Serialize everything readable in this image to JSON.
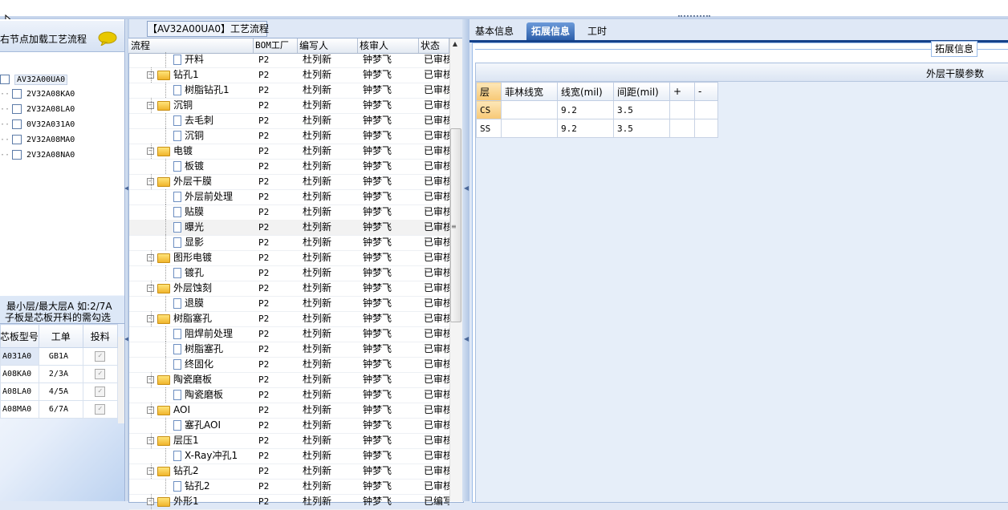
{
  "left": {
    "header": "右节点加载工艺流程",
    "root": "AV32A00UA0",
    "items": [
      "2V32A08KA0",
      "2V32A08LA0",
      "0V32A031A0",
      "2V32A08MA0",
      "2V32A08NA0"
    ],
    "hint_line1": "最小层/最大层A 如:2/7A",
    "hint_line2": "子板是芯板开料的需勾选",
    "table": {
      "headers": [
        "芯板型号",
        "工单",
        "投料"
      ],
      "rows": [
        {
          "model": "A031A0",
          "order": "GB1A"
        },
        {
          "model": "A08KA0",
          "order": "2/3A"
        },
        {
          "model": "A08LA0",
          "order": "4/5A"
        },
        {
          "model": "A08MA0",
          "order": "6/7A"
        }
      ]
    }
  },
  "middle": {
    "title": "【AV32A00UA0】工艺流程",
    "columns": [
      "流程",
      "BOM工厂",
      "编写人",
      "核审人",
      "状态"
    ],
    "rows": [
      {
        "name": "开料",
        "level": 1,
        "type": "doc",
        "bom": "P2",
        "writer": "杜列新",
        "reviewer": "钟梦飞",
        "status": "已审核"
      },
      {
        "name": "钻孔1",
        "level": 0,
        "type": "folder",
        "bom": "P2",
        "writer": "杜列新",
        "reviewer": "钟梦飞",
        "status": "已审核"
      },
      {
        "name": "树脂钻孔1",
        "level": 1,
        "type": "doc",
        "bom": "P2",
        "writer": "杜列新",
        "reviewer": "钟梦飞",
        "status": "已审核"
      },
      {
        "name": "沉铜",
        "level": 0,
        "type": "folder",
        "bom": "P2",
        "writer": "杜列新",
        "reviewer": "钟梦飞",
        "status": "已审核"
      },
      {
        "name": "去毛刺",
        "level": 1,
        "type": "doc",
        "bom": "P2",
        "writer": "杜列新",
        "reviewer": "钟梦飞",
        "status": "已审核"
      },
      {
        "name": "沉铜",
        "level": 1,
        "type": "doc",
        "bom": "P2",
        "writer": "杜列新",
        "reviewer": "钟梦飞",
        "status": "已审核"
      },
      {
        "name": "电镀",
        "level": 0,
        "type": "folder",
        "bom": "P2",
        "writer": "杜列新",
        "reviewer": "钟梦飞",
        "status": "已审核"
      },
      {
        "name": "板镀",
        "level": 1,
        "type": "doc",
        "bom": "P2",
        "writer": "杜列新",
        "reviewer": "钟梦飞",
        "status": "已审核"
      },
      {
        "name": "外层干膜",
        "level": 0,
        "type": "folder",
        "bom": "P2",
        "writer": "杜列新",
        "reviewer": "钟梦飞",
        "status": "已审核"
      },
      {
        "name": "外层前处理",
        "level": 1,
        "type": "doc",
        "bom": "P2",
        "writer": "杜列新",
        "reviewer": "钟梦飞",
        "status": "已审核"
      },
      {
        "name": "贴膜",
        "level": 1,
        "type": "doc",
        "bom": "P2",
        "writer": "杜列新",
        "reviewer": "钟梦飞",
        "status": "已审核"
      },
      {
        "name": "曝光",
        "level": 1,
        "type": "doc",
        "bom": "P2",
        "writer": "杜列新",
        "reviewer": "钟梦飞",
        "status": "已审核",
        "highlight": true
      },
      {
        "name": "显影",
        "level": 1,
        "type": "doc",
        "bom": "P2",
        "writer": "杜列新",
        "reviewer": "钟梦飞",
        "status": "已审核"
      },
      {
        "name": "图形电镀",
        "level": 0,
        "type": "folder",
        "bom": "P2",
        "writer": "杜列新",
        "reviewer": "钟梦飞",
        "status": "已审核"
      },
      {
        "name": "镀孔",
        "level": 1,
        "type": "doc",
        "bom": "P2",
        "writer": "杜列新",
        "reviewer": "钟梦飞",
        "status": "已审核"
      },
      {
        "name": "外层蚀刻",
        "level": 0,
        "type": "folder",
        "bom": "P2",
        "writer": "杜列新",
        "reviewer": "钟梦飞",
        "status": "已审核"
      },
      {
        "name": "退膜",
        "level": 1,
        "type": "doc",
        "bom": "P2",
        "writer": "杜列新",
        "reviewer": "钟梦飞",
        "status": "已审核"
      },
      {
        "name": "树脂塞孔",
        "level": 0,
        "type": "folder",
        "bom": "P2",
        "writer": "杜列新",
        "reviewer": "钟梦飞",
        "status": "已审核"
      },
      {
        "name": "阻焊前处理",
        "level": 1,
        "type": "doc",
        "bom": "P2",
        "writer": "杜列新",
        "reviewer": "钟梦飞",
        "status": "已审核"
      },
      {
        "name": "树脂塞孔",
        "level": 1,
        "type": "doc",
        "bom": "P2",
        "writer": "杜列新",
        "reviewer": "钟梦飞",
        "status": "已审核"
      },
      {
        "name": "终固化",
        "level": 1,
        "type": "doc",
        "bom": "P2",
        "writer": "杜列新",
        "reviewer": "钟梦飞",
        "status": "已审核"
      },
      {
        "name": "陶瓷磨板",
        "level": 0,
        "type": "folder",
        "bom": "P2",
        "writer": "杜列新",
        "reviewer": "钟梦飞",
        "status": "已审核"
      },
      {
        "name": "陶瓷磨板",
        "level": 1,
        "type": "doc",
        "bom": "P2",
        "writer": "杜列新",
        "reviewer": "钟梦飞",
        "status": "已审核"
      },
      {
        "name": "AOI",
        "level": 0,
        "type": "folder",
        "bom": "P2",
        "writer": "杜列新",
        "reviewer": "钟梦飞",
        "status": "已审核"
      },
      {
        "name": "塞孔AOI",
        "level": 1,
        "type": "doc",
        "bom": "P2",
        "writer": "杜列新",
        "reviewer": "钟梦飞",
        "status": "已审核"
      },
      {
        "name": "层压1",
        "level": 0,
        "type": "folder",
        "bom": "P2",
        "writer": "杜列新",
        "reviewer": "钟梦飞",
        "status": "已审核"
      },
      {
        "name": "X-Ray冲孔1",
        "level": 1,
        "type": "doc",
        "bom": "P2",
        "writer": "杜列新",
        "reviewer": "钟梦飞",
        "status": "已审核"
      },
      {
        "name": "钻孔2",
        "level": 0,
        "type": "folder",
        "bom": "P2",
        "writer": "杜列新",
        "reviewer": "钟梦飞",
        "status": "已审核"
      },
      {
        "name": "钻孔2",
        "level": 1,
        "type": "doc",
        "bom": "P2",
        "writer": "杜列新",
        "reviewer": "钟梦飞",
        "status": "已审核"
      },
      {
        "name": "外形1",
        "level": 0,
        "type": "folder",
        "bom": "P2",
        "writer": "杜列新",
        "reviewer": "钟梦飞",
        "status": "已编写"
      }
    ]
  },
  "right": {
    "tabs": [
      "基本信息",
      "拓展信息",
      "工时"
    ],
    "group_legend": "拓展信息",
    "panel_title": "外层干膜参数",
    "table": {
      "headers": [
        "层",
        "菲林线宽",
        "线宽(mil)",
        "间距(mil)",
        "+",
        "-"
      ],
      "rows": [
        {
          "layer": "CS",
          "film": "",
          "width": "9.2",
          "space": "3.5"
        },
        {
          "layer": "SS",
          "film": "",
          "width": "9.2",
          "space": "3.5"
        }
      ]
    }
  }
}
